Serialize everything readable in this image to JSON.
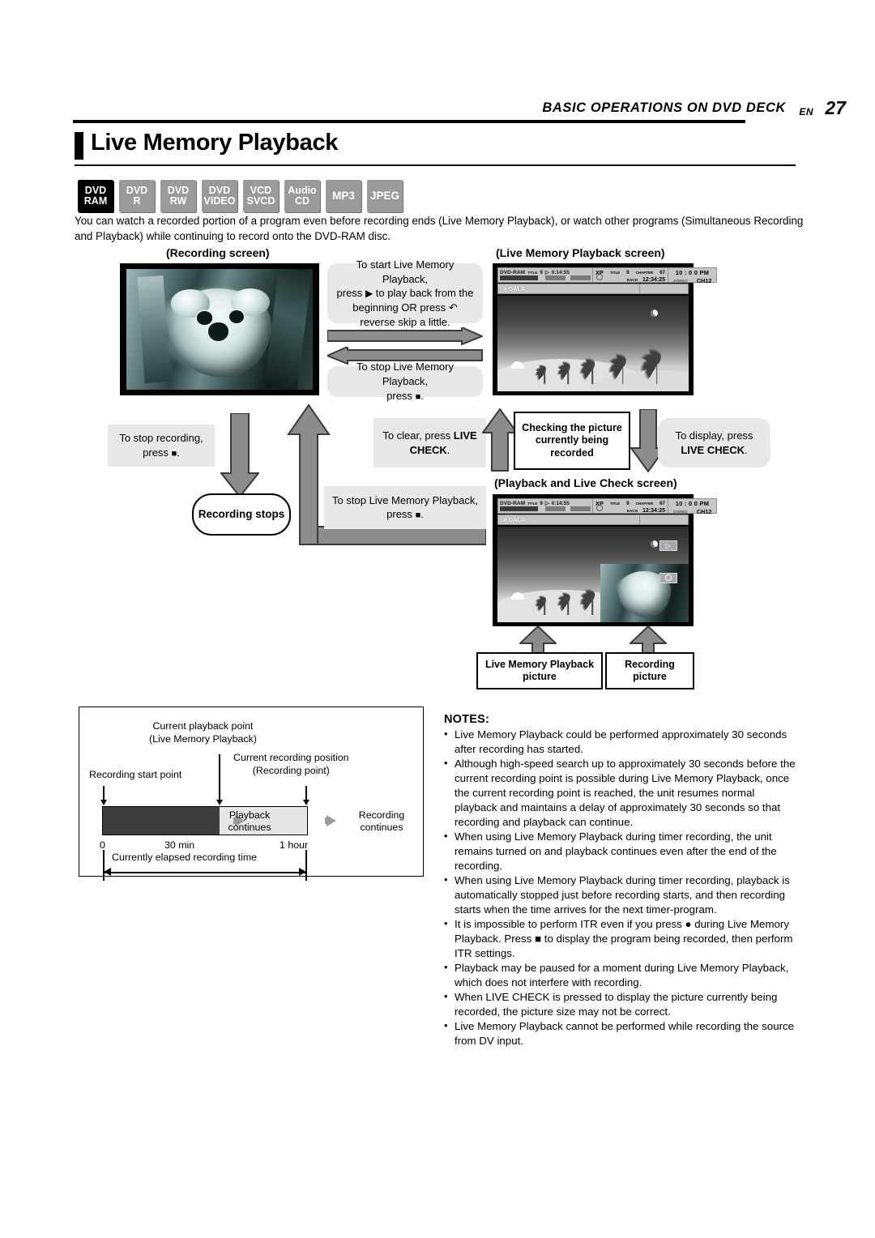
{
  "header": {
    "section": "BASIC OPERATIONS ON DVD DECK",
    "lang": "EN",
    "page": "27"
  },
  "heading": "Live Memory Playback",
  "badges": [
    {
      "line1": "DVD",
      "line2": "RAM",
      "active": true
    },
    {
      "line1": "DVD",
      "line2": "R",
      "active": false
    },
    {
      "line1": "DVD",
      "line2": "RW",
      "active": false
    },
    {
      "line1": "DVD",
      "line2": "VIDEO",
      "active": false
    },
    {
      "line1": "VCD",
      "line2": "SVCD",
      "active": false
    },
    {
      "line1": "Audio",
      "line2": "CD",
      "active": false
    },
    {
      "line1": "MP3",
      "line2": "",
      "active": false
    },
    {
      "line1": "JPEG",
      "line2": "",
      "active": false
    }
  ],
  "intro": "You can watch a recorded portion of a program even before recording ends (Live Memory Playback), or watch other programs (Simultaneous Recording and Playback) while continuing to record onto the DVD-RAM disc.",
  "captions": {
    "recording_screen": "(Recording screen)",
    "live_memory_playback_screen": "(Live Memory Playback screen)",
    "playback_and_live_check_screen": "(Playback and Live Check screen)"
  },
  "osd": {
    "disc": "DVD-RAM",
    "title_label": "TITLE",
    "title_number": "9",
    "elapsed": "0:14:55",
    "mode": "XP",
    "mid_title_label": "TITLE",
    "mid_title_number": "9",
    "chapter_label": "CHAPTER",
    "chapter_number": "67",
    "each_label": "EACH",
    "each_time": "12:34:25",
    "clock": "10 : 0 0 PM",
    "audio": "STEREO",
    "channel": "CH12",
    "program_name": "KOALA"
  },
  "callouts": {
    "start_lmp_1": "To start Live Memory Playback,",
    "start_lmp_2": "press",
    "start_lmp_3": "to play back from the",
    "start_lmp_4": "beginning OR press",
    "start_lmp_5": "reverse skip a little.",
    "stop_lmp_a_1": "To stop Live Memory Playback,",
    "stop_lmp_a_2": "press",
    "stop_recording_1": "To stop recording,",
    "stop_recording_2": "press",
    "clear_1": "To clear, press",
    "clear_bold": "LIVE CHECK",
    "clear_2": ".",
    "stop_lmp_b_1": "To stop Live Memory Playback,",
    "stop_lmp_b_2": "press",
    "display_1": "To display, press",
    "display_bold": "LIVE CHECK",
    "display_2": "."
  },
  "boxes": {
    "recording_stops": "Recording stops",
    "checking_picture": "Checking the picture currently being recorded",
    "lmp_picture": "Live Memory Playback picture",
    "recording_picture": "Recording picture"
  },
  "timeline": {
    "current_playback_point_l1": "Current playback point",
    "current_playback_point_l2": "(Live Memory Playback)",
    "current_recording_position_l1": "Current recording position",
    "current_recording_position_l2": "(Recording point)",
    "recording_start_point": "Recording start point",
    "playback_continues_l1": "Playback",
    "playback_continues_l2": "continues",
    "recording_continues_l1": "Recording",
    "recording_continues_l2": "continues",
    "axis": [
      "0",
      "30 min",
      "1 hour"
    ],
    "elapsed_label": "Currently elapsed recording time"
  },
  "notes": {
    "title": "NOTES:",
    "items": [
      "Live Memory Playback could be performed approximately 30 seconds after recording has started.",
      "Although high-speed search up to approximately 30 seconds before the current recording point is possible during Live Memory Playback, once the current recording point is reached, the unit resumes normal playback and maintains a delay of approximately 30 seconds so that recording and playback can continue.",
      "When using Live Memory Playback during timer recording, the unit remains turned on and playback continues even after the end of the recording.",
      "When using Live Memory Playback during timer recording, playback is automatically stopped just before recording starts, and then recording starts when the time arrives for the next timer-program.",
      "It is impossible to perform ITR even if you press ● during Live Memory Playback. Press ■ to display the program being recorded, then perform ITR settings.",
      "Playback may be paused for a moment during Live Memory Playback, which does not interfere with recording.",
      "When LIVE CHECK is pressed to display the picture currently being recorded, the picture size may not be correct.",
      "Live Memory Playback cannot be performed while recording the source from DV input."
    ]
  },
  "colors": {
    "badge_active": "#000000",
    "badge_inactive": "#9a9a9a",
    "callout_bg": "#e8e8e8",
    "arrow_fill": "#8c8c8c",
    "arrow_stroke": "#3b3b3b",
    "timeline_recorded": "#3d3d3d",
    "timeline_pending": "#e6e6e6"
  }
}
